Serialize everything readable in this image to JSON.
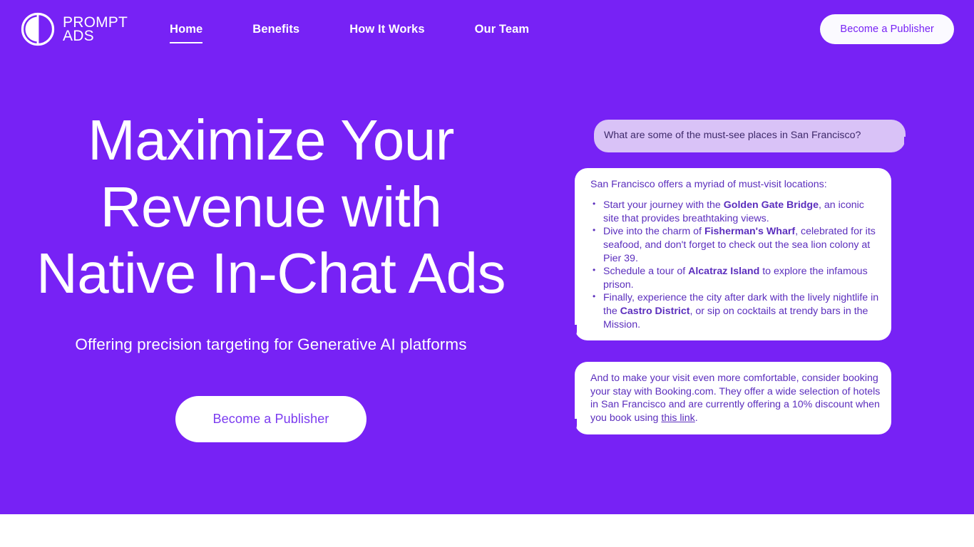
{
  "brand": {
    "logo_icon": "prompt-ads-circle-logo",
    "line1": "PROMPT",
    "line2": "ADS"
  },
  "nav": {
    "items": [
      {
        "label": "Home",
        "active": true
      },
      {
        "label": "Benefits",
        "active": false
      },
      {
        "label": "How It Works",
        "active": false
      },
      {
        "label": "Our Team",
        "active": false
      }
    ],
    "cta_label": "Become a Publisher"
  },
  "hero": {
    "headline_lines": [
      "Maximize Your",
      "Revenue with",
      "Native In-Chat Ads"
    ],
    "subheadline": "Offering precision targeting for Generative AI platforms",
    "cta_label": "Become a Publisher"
  },
  "chat": {
    "user_message": "What are some of the must-see places in San Francisco?",
    "assistant_intro": "San Francisco offers a myriad of must-visit locations:",
    "assistant_bullets": [
      {
        "pre": "Start your journey with the ",
        "bold": "Golden Gate Bridge",
        "post": ", an iconic site that provides breathtaking views."
      },
      {
        "pre": "Dive into the charm of ",
        "bold": "Fisherman's Wharf",
        "post": ", celebrated for its seafood, and don't forget to check out the sea lion colony at Pier 39."
      },
      {
        "pre": "Schedule a tour of ",
        "bold": "Alcatraz Island",
        "post": " to explore the infamous prison."
      },
      {
        "pre": "Finally, experience the city after dark with the lively nightlife in the ",
        "bold": "Castro District",
        "post": ", or sip on cocktails at trendy bars in the Mission."
      }
    ],
    "ad_message_pre": "And to make your visit even more comfortable, consider booking your stay with Booking.com. They offer a wide selection of hotels in San Francisco and are currently offering a 10% discount when you book using ",
    "ad_link_label": "this link",
    "ad_message_post": "."
  },
  "colors": {
    "brand_purple": "#7722f5",
    "bubble_user_bg": "#d9c2f7",
    "bubble_user_text": "#3f2a6b",
    "bubble_bot_bg": "#ffffff",
    "bubble_bot_text": "#5b2ebd",
    "cta_bg": "#ffffff",
    "cta_text": "#7b3bf0"
  }
}
